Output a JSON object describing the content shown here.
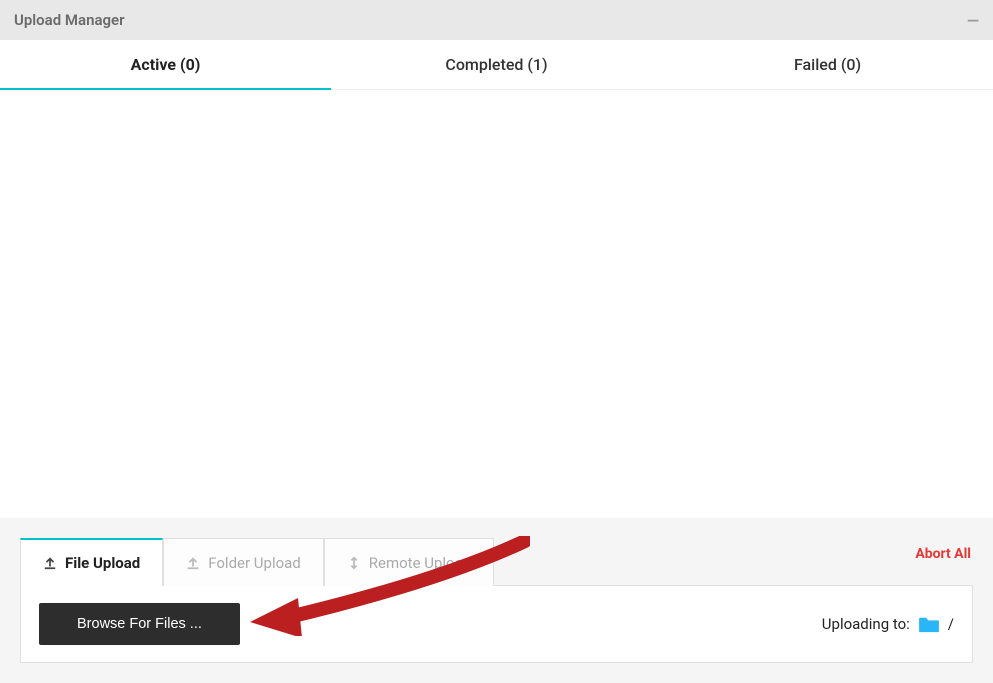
{
  "header": {
    "title": "Upload Manager"
  },
  "topTabs": {
    "active": {
      "label": "Active (0)"
    },
    "completed": {
      "label": "Completed (1)"
    },
    "failed": {
      "label": "Failed (0)"
    }
  },
  "bottom": {
    "abortAll": "Abort All",
    "uploadTabs": {
      "file": {
        "label": "File Upload"
      },
      "folder": {
        "label": "Folder Upload"
      },
      "remote": {
        "label": "Remote Upload"
      }
    },
    "browseButton": "Browse For Files ...",
    "uploadingTo": {
      "label": "Uploading to:",
      "path": "/"
    }
  }
}
